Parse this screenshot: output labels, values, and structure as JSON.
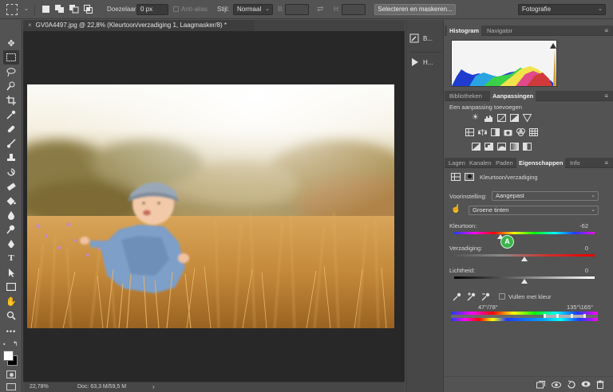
{
  "options_bar": {
    "feather_label": "Doezelaar:",
    "feather_value": "0 px",
    "antialias_label": "Anti-alias",
    "style_label": "Stijl:",
    "style_value": "Normaal",
    "width_label": "B:",
    "height_label": "H:",
    "select_mask_button": "Selecteren en maskeren...",
    "workspace": "Fotografie"
  },
  "document": {
    "tab_title": "GV0A4497.jpg @ 22,8% (Kleurtoon/verzadiging 1, Laagmasker/8) *",
    "zoom": "22,78%",
    "doc_info": "Doc: 63,3 M/59,5 M"
  },
  "mini_panels": [
    {
      "label": "B...",
      "icon": "brush-presets-icon"
    },
    {
      "label": "H...",
      "icon": "play-history-icon"
    }
  ],
  "panels": {
    "top_tabs": [
      "Histogram",
      "Navigator"
    ],
    "adj_tabs": [
      "Bibliotheken",
      "Aanpassingen"
    ],
    "adj_heading": "Een aanpassing toevoegen",
    "layer_tabs": [
      "Lagen",
      "Kanalen",
      "Paden",
      "Eigenschappen",
      "Info"
    ]
  },
  "properties": {
    "title": "Kleurtoon/verzadiging",
    "preset_label": "Voorinstelling:",
    "preset_value": "Aangepast",
    "channel_value": "Groene tinten",
    "hue_label": "Kleurtoon:",
    "hue_value": "-62",
    "hue_fraction": 0.33,
    "saturation_label": "Verzadiging:",
    "saturation_value": "0",
    "saturation_fraction": 0.5,
    "lightness_label": "Lichtheid:",
    "lightness_value": "0",
    "lightness_fraction": 0.5,
    "colorize_label": "Vullen met kleur",
    "range_left": "47°/78°",
    "range_right": "135°\\165°",
    "marker_label": "A"
  },
  "colors": {
    "accent_green": "#3bb54a",
    "panel_bg": "#535353",
    "canvas_bg": "#282828"
  }
}
